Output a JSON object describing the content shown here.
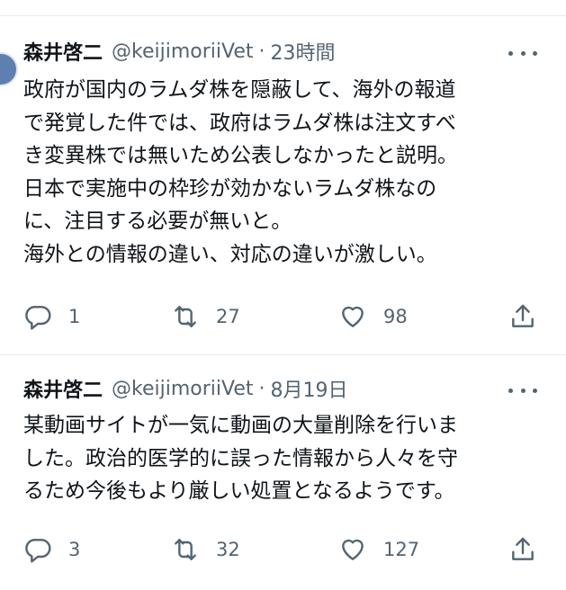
{
  "tweets": [
    {
      "name": "森井啓二",
      "handle": "@keijimoriiVet",
      "separator": "·",
      "time": "23時間",
      "text": "政府が国内のラムダ株を隠蔽して、海外の報道\nで発覚した件では、政府はラムダ株は注文すべ\nき変異株では無いため公表しなかったと説明。\n日本で実施中の枠珍が効かないラムダ株なの\nに、注目する必要が無いと。\n海外との情報の違い、対応の違いが激しい。",
      "replies": "1",
      "retweets": "27",
      "likes": "98"
    },
    {
      "name": "森井啓二",
      "handle": "@keijimoriiVet",
      "separator": "·",
      "time": "8月19日",
      "text": "某動画サイトが一気に動画の大量削除を行いま\nした。政治的医学的に誤った情報から人々を守\nるため今後もより厳しい処置となるようです。",
      "replies": "3",
      "retweets": "32",
      "likes": "127"
    }
  ],
  "icons": {
    "reply": "reply-icon",
    "retweet": "retweet-icon",
    "like": "heart-icon",
    "share": "share-icon",
    "more": "more-icon"
  },
  "colors": {
    "text": "#0f1419",
    "secondary": "#536471",
    "divider": "#e6ecf0"
  }
}
